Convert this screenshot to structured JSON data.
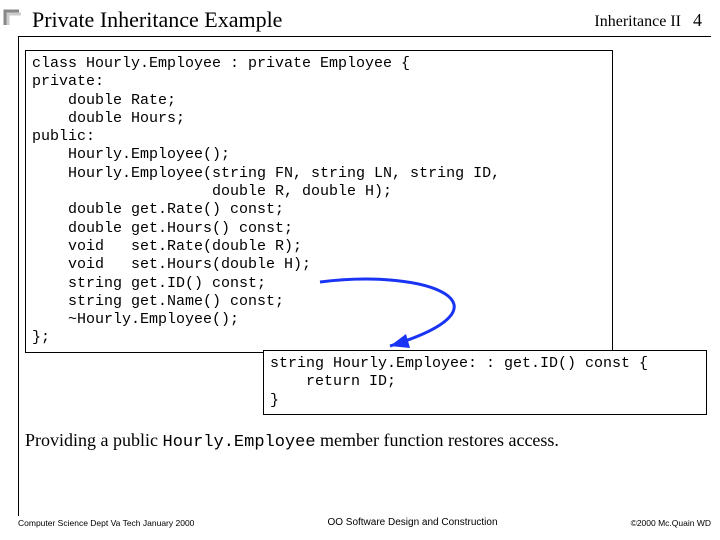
{
  "header": {
    "title": "Private Inheritance Example",
    "section": "Inheritance II",
    "page": "4"
  },
  "code_main": "class Hourly.Employee : private Employee {\nprivate:\n    double Rate;\n    double Hours;\npublic:\n    Hourly.Employee();\n    Hourly.Employee(string FN, string LN, string ID,\n                    double R, double H);\n    double get.Rate() const;\n    double get.Hours() const;\n    void   set.Rate(double R);\n    void   set.Hours(double H);\n    string get.ID() const;\n    string get.Name() const;\n    ~Hourly.Employee();\n};",
  "code_small": "string Hourly.Employee: : get.ID() const {\n    return ID;\n}",
  "explain": {
    "pre": "Providing a public ",
    "mono": "Hourly.Employee",
    "post": " member function restores access."
  },
  "footer": {
    "left": "Computer Science Dept Va Tech January 2000",
    "center": "OO Software Design and Construction",
    "right": "©2000 Mc.Quain WD"
  }
}
